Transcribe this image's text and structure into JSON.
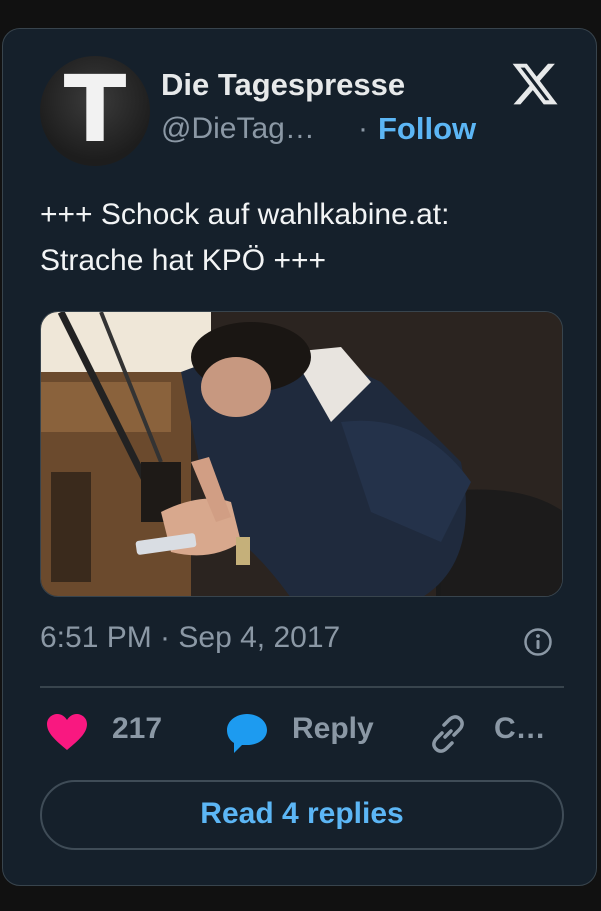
{
  "author": {
    "avatar_letter": "T",
    "name": "Die Tagespresse",
    "handle": "@DieTag…",
    "separator": "·",
    "follow_label": "Follow"
  },
  "tweet": {
    "text_lines": [
      "+++ Schock auf wahlkabine.at:",
      "Strache hat KPÖ +++"
    ],
    "timestamp": "6:51 PM · Sep 4, 2017"
  },
  "actions": {
    "like_count": "217",
    "reply_label": "Reply",
    "copy_label": "C…"
  },
  "read_replies_label": "Read 4 replies",
  "icons": {
    "brand": "x-logo-icon",
    "info": "info-icon",
    "like": "heart-icon",
    "reply": "speech-bubble-icon",
    "copy": "link-icon"
  },
  "colors": {
    "background": "#15202b",
    "accent_blue": "#5cb6f5",
    "heart_pink": "#f91880",
    "reply_blue": "#1d9bf0",
    "muted_text": "#8b98a5"
  }
}
